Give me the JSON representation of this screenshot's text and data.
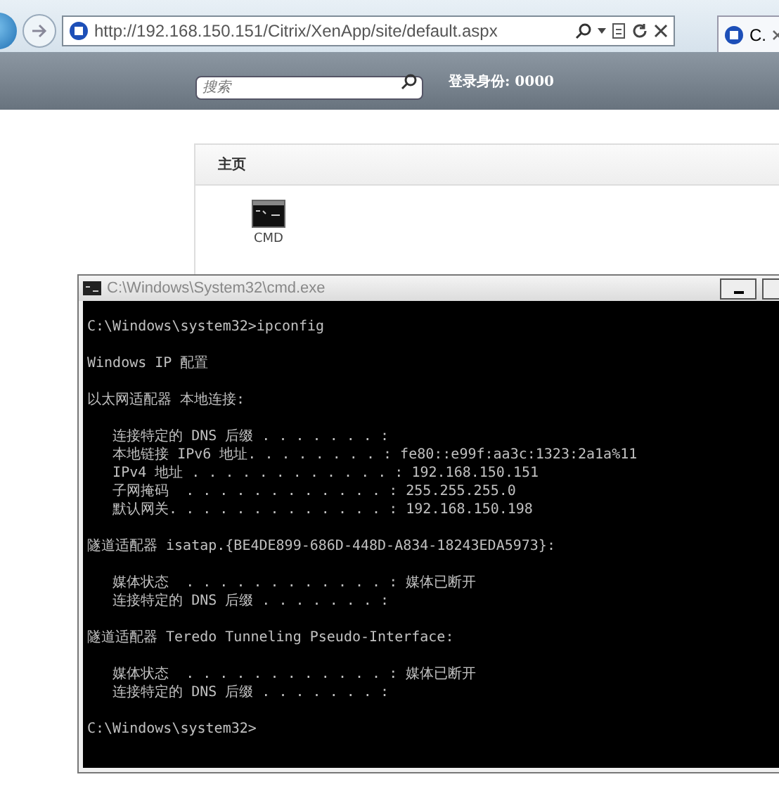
{
  "browser": {
    "url": "http://192.168.150.151/Citrix/XenApp/site/default.aspx",
    "tab": {
      "title": "C.",
      "selected": true
    }
  },
  "site_header": {
    "search": {
      "placeholder": "搜索"
    },
    "login": "登录身份: 0000"
  },
  "panel": {
    "title": "主页",
    "apps": [
      {
        "label": "CMD"
      }
    ]
  },
  "console": {
    "title": "C:\\Windows\\System32\\cmd.exe",
    "blocks": [
      [
        "C:\\Windows\\system32>ipconfig"
      ],
      [
        "Windows IP 配置"
      ],
      [
        "以太网适配器 本地连接:"
      ],
      [
        "   连接特定的 DNS 后缀 . . . . . . . :",
        "   本地链接 IPv6 地址. . . . . . . . : fe80::e99f:aa3c:1323:2a1a%11",
        "   IPv4 地址 . . . . . . . . . . . . : 192.168.150.151",
        "   子网掩码  . . . . . . . . . . . . : 255.255.255.0",
        "   默认网关. . . . . . . . . . . . . : 192.168.150.198"
      ],
      [
        "隧道适配器 isatap.{BE4DE899-686D-448D-A834-18243EDA5973}:"
      ],
      [
        "   媒体状态  . . . . . . . . . . . . : 媒体已断开",
        "   连接特定的 DNS 后缀 . . . . . . . :"
      ],
      [
        "隧道适配器 Teredo Tunneling Pseudo-Interface:"
      ],
      [
        "   媒体状态  . . . . . . . . . . . . : 媒体已断开",
        "   连接特定的 DNS 后缀 . . . . . . . :"
      ],
      [
        "C:\\Windows\\system32>"
      ]
    ]
  }
}
